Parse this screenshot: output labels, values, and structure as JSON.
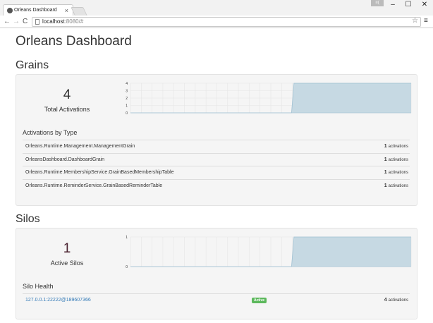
{
  "browser": {
    "tab_title": "Orleans Dashboard",
    "tab_close": "×",
    "profile_badge": "≡(",
    "win_min": "–",
    "win_max": "☐",
    "win_close": "✕",
    "back": "←",
    "forward": "→",
    "reload": "C",
    "url_host": "localhost",
    "url_rest": ":8080/#",
    "star": "☆",
    "menu": "≡"
  },
  "page_title": "Orleans Dashboard",
  "grains": {
    "heading": "Grains",
    "total_value": "4",
    "total_label": "Total Activations",
    "by_type_title": "Activations by Type",
    "rows": [
      {
        "name": "Orleans.Runtime.Management.ManagementGrain",
        "count": "1",
        "unit": "activations"
      },
      {
        "name": "OrleansDashboard.DashboardGrain",
        "count": "1",
        "unit": "activations"
      },
      {
        "name": "Orleans.Runtime.MembershipService.GrainBasedMembershipTable",
        "count": "1",
        "unit": "activations"
      },
      {
        "name": "Orleans.Runtime.ReminderService.GrainBasedReminderTable",
        "count": "1",
        "unit": "activations"
      }
    ]
  },
  "silos": {
    "heading": "Silos",
    "total_value": "1",
    "total_label": "Active Silos",
    "health_title": "Silo Health",
    "rows": [
      {
        "address": "127.0.0.1:22222@189607366",
        "status": "Active",
        "count": "4",
        "unit": "activations"
      }
    ]
  },
  "chart_data": [
    {
      "type": "area",
      "y_ticks": [
        0,
        1,
        2,
        3,
        4
      ],
      "ylim": [
        0,
        4
      ],
      "grid": true,
      "values": [
        0,
        0,
        0,
        0,
        0,
        0,
        0,
        0,
        0,
        0,
        0,
        0,
        0,
        0,
        0,
        0,
        0,
        0,
        0,
        0,
        0,
        0,
        0,
        0,
        0,
        0,
        0,
        0,
        0,
        0,
        0,
        0,
        0,
        0,
        0,
        0,
        0,
        0,
        0,
        0,
        0,
        0,
        0,
        0,
        0,
        0,
        0,
        0,
        0,
        0,
        0,
        0,
        0,
        0,
        0,
        0,
        0,
        0,
        0,
        0,
        0,
        0,
        0,
        0,
        0,
        0,
        0,
        4,
        4,
        4,
        4,
        4,
        4,
        4,
        4,
        4,
        4,
        4,
        4,
        4,
        4,
        4,
        4,
        4,
        4,
        4,
        4,
        4,
        4,
        4,
        4,
        4,
        4,
        4,
        4,
        4,
        4,
        4,
        4,
        4,
        4,
        4,
        4,
        4,
        4,
        4,
        4,
        4,
        4,
        4,
        4,
        4,
        4,
        4,
        4,
        4
      ]
    },
    {
      "type": "area",
      "y_ticks": [
        0,
        1
      ],
      "ylim": [
        0,
        1
      ],
      "grid": true,
      "values": [
        0,
        0,
        0,
        0,
        0,
        0,
        0,
        0,
        0,
        0,
        0,
        0,
        0,
        0,
        0,
        0,
        0,
        0,
        0,
        0,
        0,
        0,
        0,
        0,
        0,
        0,
        0,
        0,
        0,
        0,
        0,
        0,
        0,
        0,
        0,
        0,
        0,
        0,
        0,
        0,
        0,
        0,
        0,
        0,
        0,
        0,
        0,
        0,
        0,
        0,
        0,
        0,
        0,
        0,
        0,
        0,
        0,
        0,
        0,
        0,
        0,
        0,
        0,
        0,
        0,
        0,
        0,
        1,
        1,
        1,
        1,
        1,
        1,
        1,
        1,
        1,
        1,
        1,
        1,
        1,
        1,
        1,
        1,
        1,
        1,
        1,
        1,
        1,
        1,
        1,
        1,
        1,
        1,
        1,
        1,
        1,
        1,
        1,
        1,
        1,
        1,
        1,
        1,
        1,
        1,
        1,
        1,
        1,
        1,
        1,
        1,
        1,
        1,
        1,
        1,
        1
      ]
    }
  ],
  "colors": {
    "area_fill": "#c6d9e3",
    "area_line": "#9fc0d2",
    "baseline": "#a8c4d6",
    "grid": "#e6e6e6",
    "link": "#337ab7",
    "badge_active": "#5cb85c"
  }
}
